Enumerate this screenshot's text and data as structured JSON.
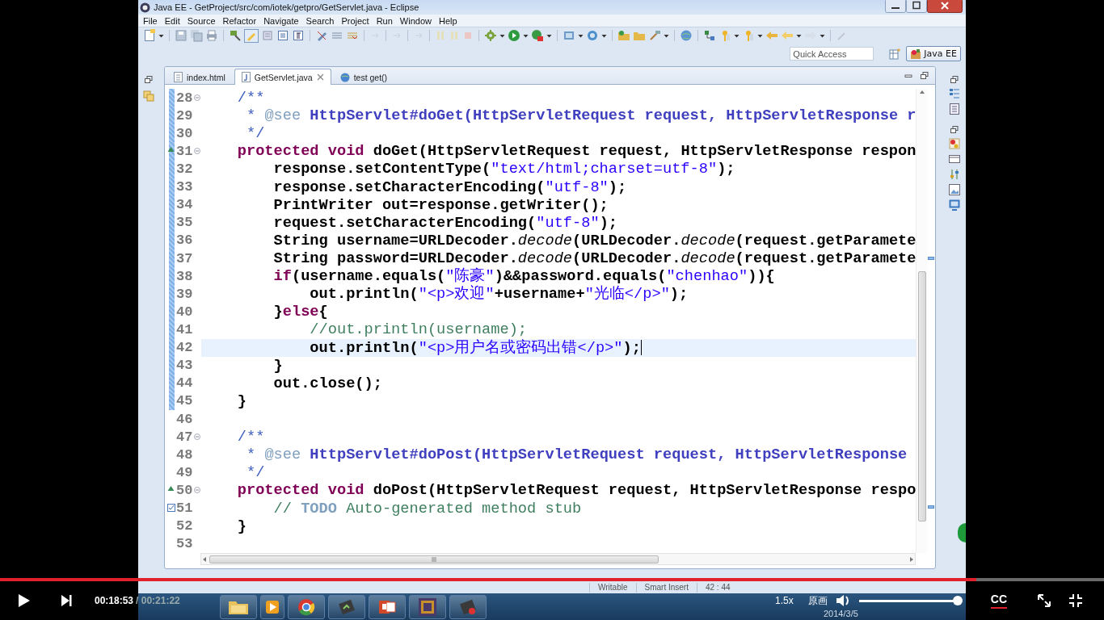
{
  "window": {
    "title": "Java EE - GetProject/src/com/iotek/getpro/GetServlet.java - Eclipse"
  },
  "menu": [
    "File",
    "Edit",
    "Source",
    "Refactor",
    "Navigate",
    "Search",
    "Project",
    "Run",
    "Window",
    "Help"
  ],
  "quick_access": {
    "placeholder": "Quick Access"
  },
  "perspective": {
    "label": "Java EE",
    "selected": true
  },
  "editor_tabs": [
    {
      "label": "index.html",
      "kind": "html",
      "selected": false,
      "closable": false
    },
    {
      "label": "GetServlet.java",
      "kind": "java",
      "selected": true,
      "closable": true
    },
    {
      "label": "test get()",
      "kind": "web",
      "selected": false,
      "closable": false
    }
  ],
  "code_lines": [
    {
      "number": "28",
      "changed": true,
      "current": false,
      "fold": true,
      "override_marker": false,
      "task_marker": false,
      "segments": [
        {
          "kind": "doc",
          "text": "    /**"
        }
      ]
    },
    {
      "number": "29",
      "changed": true,
      "current": false,
      "fold": false,
      "override_marker": false,
      "task_marker": false,
      "segments": [
        {
          "kind": "doc",
          "text": "     * "
        },
        {
          "kind": "doctag",
          "text": "@see"
        },
        {
          "kind": "doclink",
          "text": " HttpServlet#doGet(HttpServletRequest request, HttpServletResponse r"
        }
      ]
    },
    {
      "number": "30",
      "changed": true,
      "current": false,
      "fold": false,
      "override_marker": false,
      "task_marker": false,
      "segments": [
        {
          "kind": "doc",
          "text": "     */"
        }
      ]
    },
    {
      "number": "31",
      "changed": true,
      "current": false,
      "fold": true,
      "override_marker": true,
      "task_marker": false,
      "segments": [
        {
          "kind": "keyword",
          "text": "    protected void"
        },
        {
          "kind": "plain",
          "text": " doGet(HttpServletRequest request, HttpServletResponse respon"
        }
      ]
    },
    {
      "number": "32",
      "changed": true,
      "current": false,
      "fold": false,
      "override_marker": false,
      "task_marker": false,
      "segments": [
        {
          "kind": "plain",
          "text": "        response.setContentType("
        },
        {
          "kind": "string",
          "text": "\"text/html;charset=utf-8\""
        },
        {
          "kind": "plain",
          "text": ");"
        }
      ]
    },
    {
      "number": "33",
      "changed": true,
      "current": false,
      "fold": false,
      "override_marker": false,
      "task_marker": false,
      "segments": [
        {
          "kind": "plain",
          "text": "        response.setCharacterEncoding("
        },
        {
          "kind": "string",
          "text": "\"utf-8\""
        },
        {
          "kind": "plain",
          "text": ");"
        }
      ]
    },
    {
      "number": "34",
      "changed": true,
      "current": false,
      "fold": false,
      "override_marker": false,
      "task_marker": false,
      "segments": [
        {
          "kind": "plain",
          "text": "        PrintWriter out=response.getWriter();"
        }
      ]
    },
    {
      "number": "35",
      "changed": true,
      "current": false,
      "fold": false,
      "override_marker": false,
      "task_marker": false,
      "segments": [
        {
          "kind": "plain",
          "text": "        request.setCharacterEncoding("
        },
        {
          "kind": "string",
          "text": "\"utf-8\""
        },
        {
          "kind": "plain",
          "text": ");"
        }
      ]
    },
    {
      "number": "36",
      "changed": true,
      "current": false,
      "fold": false,
      "override_marker": false,
      "task_marker": false,
      "segments": [
        {
          "kind": "plain",
          "text": "        String username=URLDecoder."
        },
        {
          "kind": "static",
          "text": "decode"
        },
        {
          "kind": "plain",
          "text": "(URLDecoder."
        },
        {
          "kind": "static",
          "text": "decode"
        },
        {
          "kind": "plain",
          "text": "(request.getParamete"
        }
      ]
    },
    {
      "number": "37",
      "changed": true,
      "current": false,
      "fold": false,
      "override_marker": false,
      "task_marker": false,
      "segments": [
        {
          "kind": "plain",
          "text": "        String password=URLDecoder."
        },
        {
          "kind": "static",
          "text": "decode"
        },
        {
          "kind": "plain",
          "text": "(URLDecoder."
        },
        {
          "kind": "static",
          "text": "decode"
        },
        {
          "kind": "plain",
          "text": "(request.getParamete"
        }
      ]
    },
    {
      "number": "38",
      "changed": true,
      "current": false,
      "fold": false,
      "override_marker": false,
      "task_marker": false,
      "segments": [
        {
          "kind": "keyword",
          "text": "        if"
        },
        {
          "kind": "plain",
          "text": "(username.equals("
        },
        {
          "kind": "string",
          "text": "\"陈豪\""
        },
        {
          "kind": "plain",
          "text": ")&&password.equals("
        },
        {
          "kind": "string",
          "text": "\"chenhao\""
        },
        {
          "kind": "plain",
          "text": ")){"
        }
      ]
    },
    {
      "number": "39",
      "changed": true,
      "current": false,
      "fold": false,
      "override_marker": false,
      "task_marker": false,
      "segments": [
        {
          "kind": "plain",
          "text": "            out.println("
        },
        {
          "kind": "string",
          "text": "\"<p>欢迎\""
        },
        {
          "kind": "plain",
          "text": "+username+"
        },
        {
          "kind": "string",
          "text": "\"光临</p>\""
        },
        {
          "kind": "plain",
          "text": ");"
        }
      ]
    },
    {
      "number": "40",
      "changed": true,
      "current": false,
      "fold": false,
      "override_marker": false,
      "task_marker": false,
      "segments": [
        {
          "kind": "plain",
          "text": "        }"
        },
        {
          "kind": "keyword",
          "text": "else"
        },
        {
          "kind": "plain",
          "text": "{"
        }
      ]
    },
    {
      "number": "41",
      "changed": true,
      "current": false,
      "fold": false,
      "override_marker": false,
      "task_marker": false,
      "segments": [
        {
          "kind": "comment",
          "text": "            //out.println(username);"
        }
      ]
    },
    {
      "number": "42",
      "changed": true,
      "current": true,
      "fold": false,
      "override_marker": false,
      "task_marker": false,
      "segments": [
        {
          "kind": "plain",
          "text": "            out.println("
        },
        {
          "kind": "string",
          "text": "\"<p>用户名或密码出错</p>\""
        },
        {
          "kind": "plain",
          "text": ");"
        }
      ]
    },
    {
      "number": "43",
      "changed": true,
      "current": false,
      "fold": false,
      "override_marker": false,
      "task_marker": false,
      "segments": [
        {
          "kind": "plain",
          "text": "        }"
        }
      ]
    },
    {
      "number": "44",
      "changed": true,
      "current": false,
      "fold": false,
      "override_marker": false,
      "task_marker": false,
      "segments": [
        {
          "kind": "plain",
          "text": "        out.close();"
        }
      ]
    },
    {
      "number": "45",
      "changed": true,
      "current": false,
      "fold": false,
      "override_marker": false,
      "task_marker": false,
      "segments": [
        {
          "kind": "plain",
          "text": "    }"
        }
      ]
    },
    {
      "number": "46",
      "changed": false,
      "current": false,
      "fold": false,
      "override_marker": false,
      "task_marker": false
    },
    {
      "number": "47",
      "changed": false,
      "current": false,
      "fold": true,
      "override_marker": false,
      "task_marker": false,
      "segments": [
        {
          "kind": "doc",
          "text": "    /**"
        }
      ]
    },
    {
      "number": "48",
      "changed": false,
      "current": false,
      "fold": false,
      "override_marker": false,
      "task_marker": false,
      "segments": [
        {
          "kind": "doc",
          "text": "     * "
        },
        {
          "kind": "doctag",
          "text": "@see"
        },
        {
          "kind": "doclink",
          "text": " HttpServlet#doPost(HttpServletRequest request, HttpServletResponse"
        }
      ]
    },
    {
      "number": "49",
      "changed": false,
      "current": false,
      "fold": false,
      "override_marker": false,
      "task_marker": false,
      "segments": [
        {
          "kind": "doc",
          "text": "     */"
        }
      ]
    },
    {
      "number": "50",
      "changed": false,
      "current": false,
      "fold": true,
      "override_marker": true,
      "task_marker": false,
      "segments": [
        {
          "kind": "keyword",
          "text": "    protected void"
        },
        {
          "kind": "plain",
          "text": " doPost(HttpServletRequest request, HttpServletResponse respo"
        }
      ]
    },
    {
      "number": "51",
      "changed": false,
      "current": false,
      "fold": false,
      "override_marker": false,
      "task_marker": true,
      "segments": [
        {
          "kind": "comment",
          "text": "        // "
        },
        {
          "kind": "task",
          "text": "TODO"
        },
        {
          "kind": "comment",
          "text": " Auto-generated method stub"
        }
      ]
    },
    {
      "number": "52",
      "changed": false,
      "current": false,
      "fold": false,
      "override_marker": false,
      "task_marker": false,
      "segments": [
        {
          "kind": "plain",
          "text": "    }"
        }
      ]
    },
    {
      "number": "53",
      "changed": false,
      "current": false,
      "fold": false,
      "override_marker": false,
      "task_marker": false
    }
  ],
  "status_bar": [
    "Writable",
    "Smart Insert",
    "42 : 44"
  ],
  "taskbar": {
    "date": "2014/3/5"
  },
  "player": {
    "elapsed": "00:18:53",
    "duration": "/ 00:21:22",
    "progress": {
      "level": 0.884
    },
    "speed": "1.5x",
    "quality": "原画",
    "volume": {
      "level": 1
    },
    "captions": {
      "label": "CC",
      "on": true
    }
  }
}
